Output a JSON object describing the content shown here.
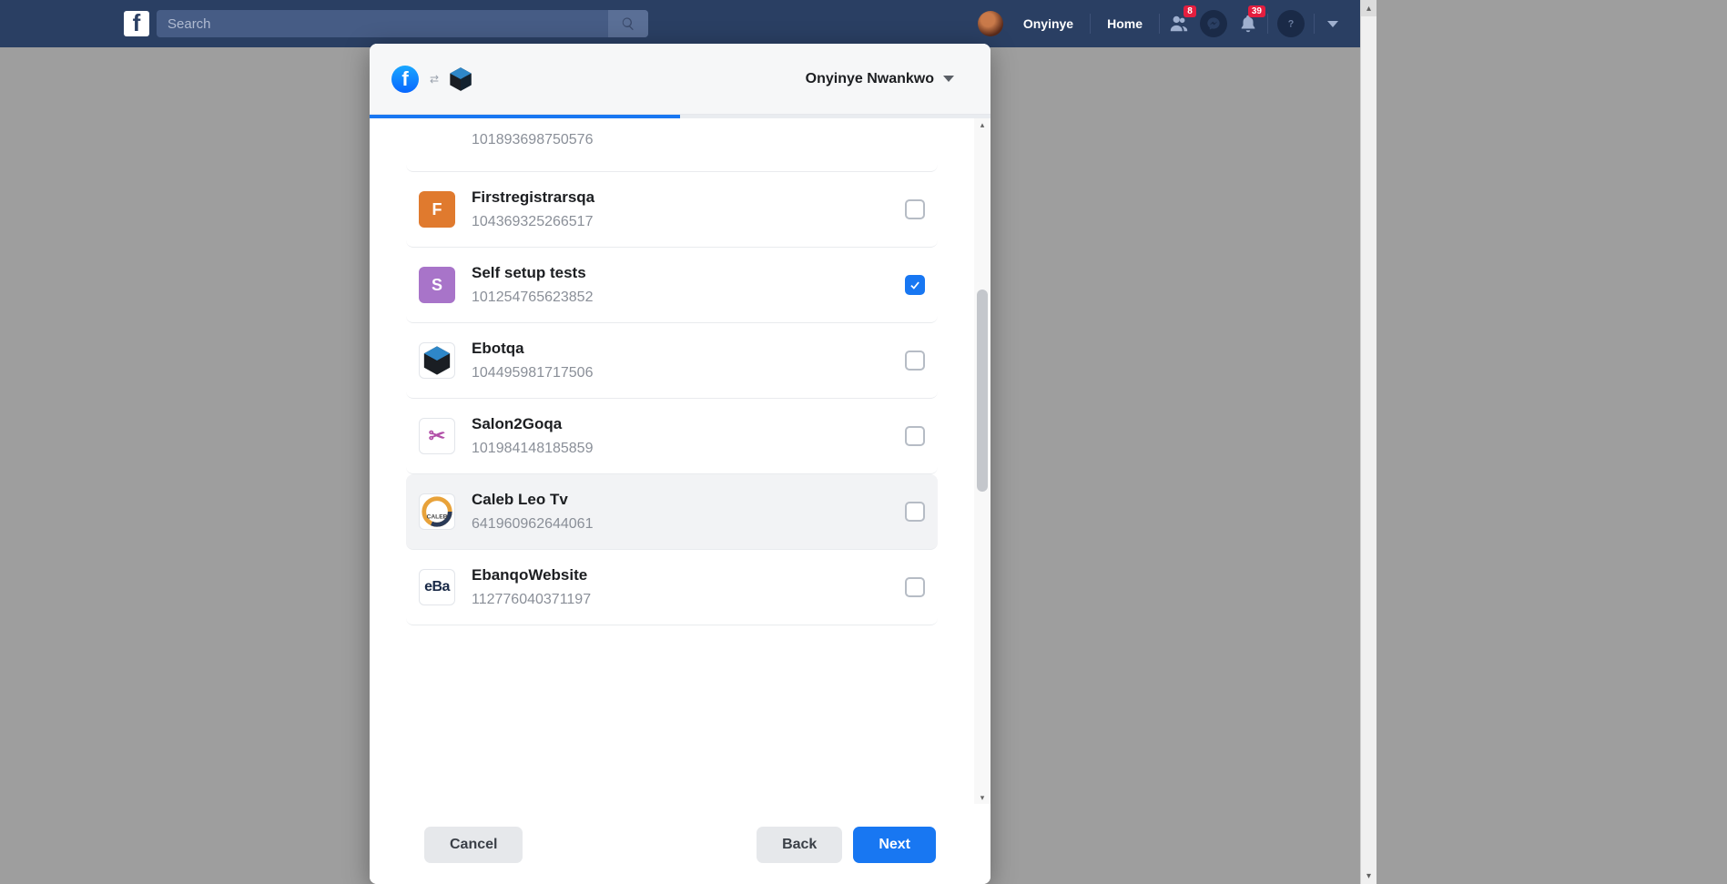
{
  "topbar": {
    "search_placeholder": "Search",
    "profile_name": "Onyinye",
    "home_label": "Home",
    "badge_friends": "8",
    "badge_notifications": "39"
  },
  "dialog": {
    "user_name": "Onyinye Nwankwo",
    "progress_percent": 50,
    "partial_top_id": "101893698750576",
    "rows": [
      {
        "name": "Firstregistrarsqa",
        "id": "104369325266517",
        "checked": false,
        "thumb_letter": "F",
        "thumb_bg": "#e07a2e",
        "hover": false,
        "thumb_kind": "letter"
      },
      {
        "name": "Self setup tests",
        "id": "101254765623852",
        "checked": true,
        "thumb_letter": "S",
        "thumb_bg": "#a874c9",
        "hover": false,
        "thumb_kind": "letter"
      },
      {
        "name": "Ebotqa",
        "id": "104495981717506",
        "checked": false,
        "thumb_bg": "#ffffff",
        "hover": false,
        "thumb_kind": "hex"
      },
      {
        "name": "Salon2Goqa",
        "id": "101984148185859",
        "checked": false,
        "thumb_bg": "#ffffff",
        "hover": false,
        "thumb_kind": "scissors"
      },
      {
        "name": "Caleb Leo Tv",
        "id": "641960962644061",
        "checked": false,
        "thumb_bg": "#ffffff",
        "hover": true,
        "thumb_kind": "ring"
      },
      {
        "name": "EbanqoWebsite",
        "id": "112776040371197",
        "checked": false,
        "thumb_bg": "#ffffff",
        "hover": false,
        "thumb_kind": "eba"
      }
    ],
    "buttons": {
      "cancel": "Cancel",
      "back": "Back",
      "next": "Next"
    }
  }
}
